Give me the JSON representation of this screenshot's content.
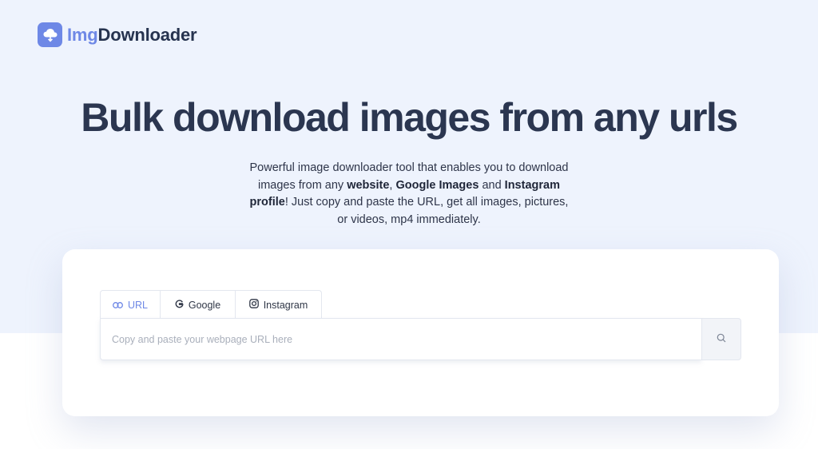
{
  "brand": {
    "name_part1": "Img",
    "name_part2": "Downloader",
    "accent_color": "#6e88e6",
    "logo_icon": "cloud-download-icon"
  },
  "hero": {
    "title": "Bulk download images from any urls",
    "description": {
      "p1": "Powerful image downloader tool that enables you to download images from any ",
      "b1": "website",
      "p2": ", ",
      "b2": "Google Images",
      "p3": " and ",
      "b3": "Instagram profile",
      "p4": "! Just copy and paste the URL, get all images, pictures, or videos, mp4 immediately."
    }
  },
  "tabs": [
    {
      "label": "URL",
      "icon": "link-icon",
      "active": true
    },
    {
      "label": "Google",
      "icon": "google-icon",
      "active": false
    },
    {
      "label": "Instagram",
      "icon": "instagram-icon",
      "active": false
    }
  ],
  "search": {
    "placeholder": "Copy and paste your webpage URL here",
    "value": "",
    "button_icon": "search-icon"
  }
}
